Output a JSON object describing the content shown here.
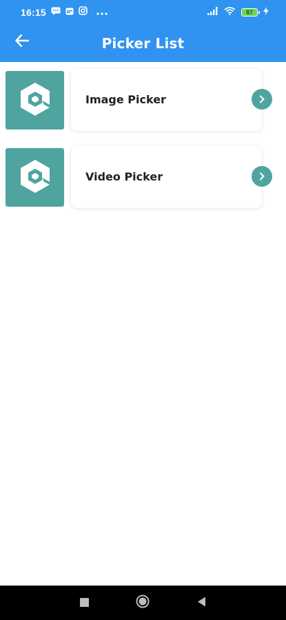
{
  "status_bar": {
    "time": "16:15",
    "notification_icons": [
      "message-icon",
      "calendar-icon",
      "instagram-icon",
      "more-dots-icon"
    ],
    "battery_level": "87",
    "icons": [
      "signal-icon",
      "wifi-icon",
      "battery-icon",
      "charging-icon"
    ]
  },
  "app_bar": {
    "title": "Picker List",
    "back_icon": "arrow-left-icon",
    "color": "#2f93ef"
  },
  "items": [
    {
      "label": "Image Picker",
      "thumbnail_icon": "logo-icon",
      "action_icon": "chevron-right-icon"
    },
    {
      "label": "Video Picker",
      "thumbnail_icon": "logo-icon",
      "action_icon": "chevron-right-icon"
    }
  ],
  "theme": {
    "accent": "#4fa49f",
    "background": "#ffffff"
  },
  "nav_bar": {
    "buttons": [
      "recents-square-icon",
      "home-circle-icon",
      "back-triangle-icon"
    ]
  }
}
